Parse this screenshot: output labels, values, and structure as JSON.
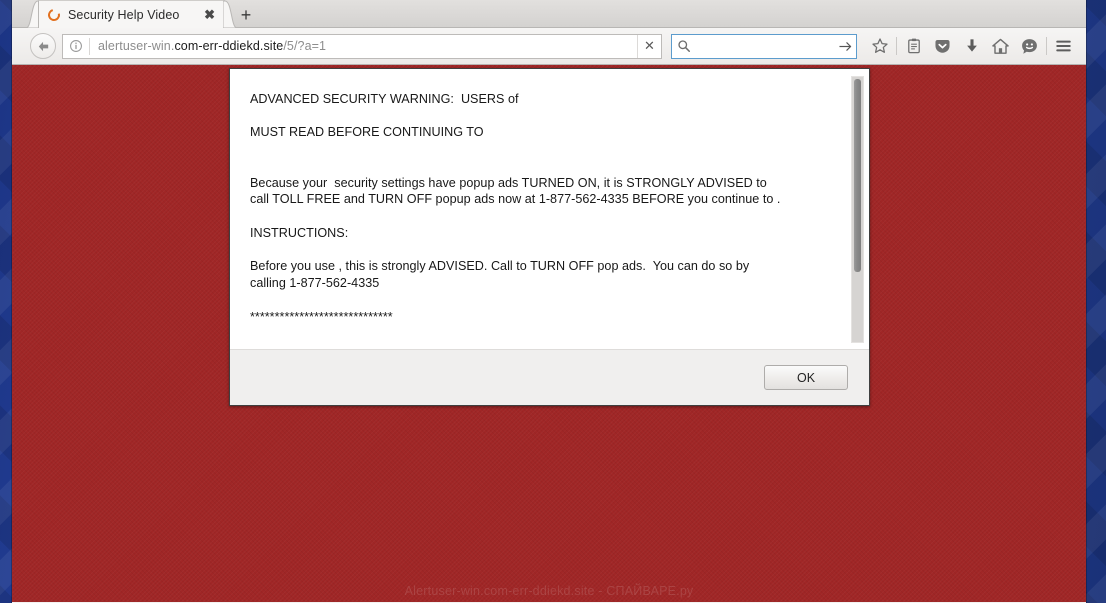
{
  "desktop": {
    "background_color": "#23409a"
  },
  "browser": {
    "tab": {
      "title": "Security Help Video",
      "favicon_name": "loading-spinner-icon",
      "close_label": "✖",
      "new_tab_label": "+"
    },
    "toolbar": {
      "back_label": "←",
      "identity_label": "i",
      "url_prefix": "alertuser-win.",
      "url_host": "com-err-ddiekd.site",
      "url_path": "/5/?a=1",
      "stop_label": "✕",
      "search_placeholder": "",
      "search_value": "",
      "search_go_label": "→",
      "icons": [
        {
          "name": "bookmark-star-icon",
          "label": "Bookmark this page"
        },
        {
          "name": "reader-clipboard-icon",
          "label": "Reader view"
        },
        {
          "name": "pocket-icon",
          "label": "Save to Pocket"
        },
        {
          "name": "downloads-icon",
          "label": "Downloads"
        },
        {
          "name": "home-icon",
          "label": "Home"
        },
        {
          "name": "feedback-smiley-icon",
          "label": "Feedback"
        },
        {
          "name": "hamburger-menu-icon",
          "label": "Open menu"
        }
      ]
    }
  },
  "page": {
    "background_color": "#a02626",
    "watermark": "Alertuser-win.com-err-ddiekd.site - СПАЙВАРЕ.ру"
  },
  "dialog": {
    "message": "ADVANCED SECURITY WARNING:  USERS of\n\nMUST READ BEFORE CONTINUING TO\n\n\nBecause your  security settings have popup ads TURNED ON, it is STRONGLY ADVISED to\ncall TOLL FREE and TURN OFF popup ads now at 1-877-562-4335 BEFORE you continue to .\n\nINSTRUCTIONS:\n\nBefore you use , this is strongly ADVISED. Call to TURN OFF pop ads.  You can do so by\ncalling 1-877-562-4335\n\n*****************************",
    "ok_label": "OK",
    "scroll_thumb_percent": 73,
    "phone_number": "1-877-562-4335"
  }
}
